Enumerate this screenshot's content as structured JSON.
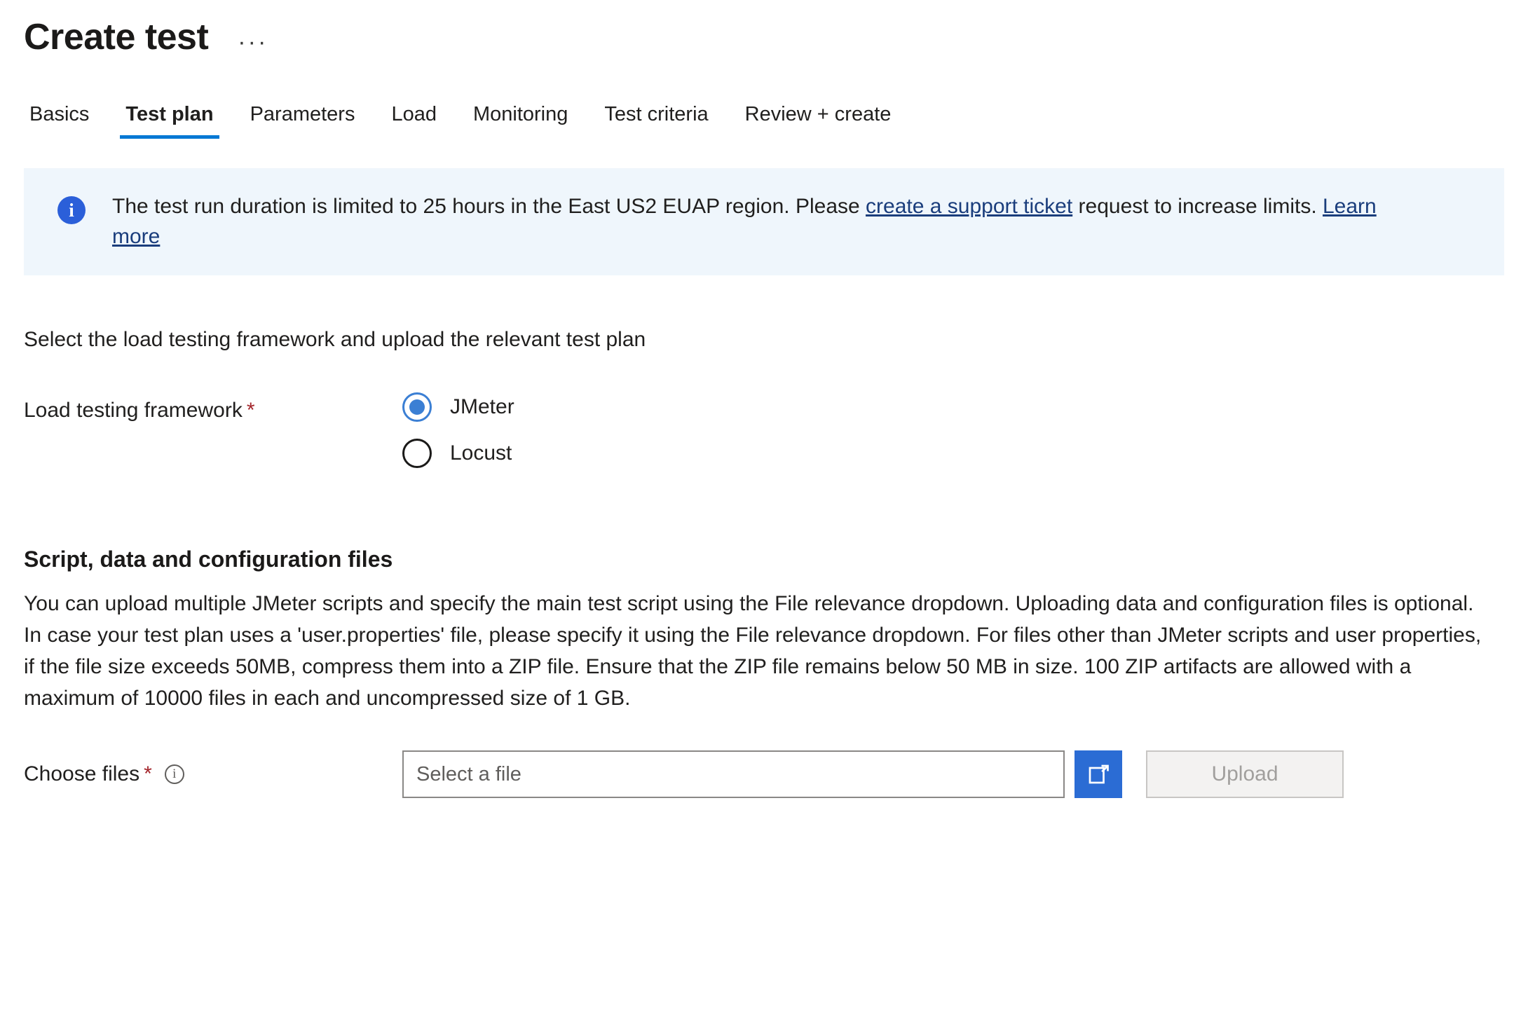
{
  "header": {
    "title": "Create test",
    "more_menu": "···"
  },
  "tabs": [
    {
      "label": "Basics",
      "active": false
    },
    {
      "label": "Test plan",
      "active": true
    },
    {
      "label": "Parameters",
      "active": false
    },
    {
      "label": "Load",
      "active": false
    },
    {
      "label": "Monitoring",
      "active": false
    },
    {
      "label": "Test criteria",
      "active": false
    },
    {
      "label": "Review + create",
      "active": false
    }
  ],
  "banner": {
    "icon": "info-icon",
    "icon_glyph": "i",
    "text_before_link": "The test run duration is limited to 25 hours in the East US2 EUAP region. Please ",
    "link1": "create a support ticket",
    "text_between": " request to increase limits. ",
    "link2": "Learn more",
    "background": "#eff6fc",
    "icon_color": "#2b5fd9",
    "link_color": "#1a3d7c"
  },
  "framework_section": {
    "lead": "Select the load testing framework and upload the relevant test plan",
    "label": "Load testing framework",
    "required_mark": "*",
    "options": [
      {
        "label": "JMeter",
        "selected": true
      },
      {
        "label": "Locust",
        "selected": false
      }
    ],
    "selected_value": "JMeter",
    "accent": "#3b7fd4"
  },
  "script_section": {
    "heading": "Script, data and configuration files",
    "body": "You can upload multiple JMeter scripts and specify the main test script using the File relevance dropdown. Uploading data and configuration files is optional. In case your test plan uses a 'user.properties' file, please specify it using the File relevance dropdown. For files other than JMeter scripts and user properties, if the file size exceeds 50MB, compress them into a ZIP file. Ensure that the ZIP file remains below 50 MB in size. 100 ZIP artifacts are allowed with a maximum of 10000 files in each and uncompressed size of 1 GB."
  },
  "choose_files": {
    "label": "Choose files",
    "required_mark": "*",
    "info_glyph": "i",
    "file_placeholder": "Select a file",
    "file_value": "",
    "browse_icon": "folder-open-icon",
    "upload_label": "Upload",
    "upload_disabled": true,
    "browse_color": "#2b6cd4"
  },
  "colors": {
    "required_red": "#a4262c",
    "tab_underline": "#0078d4"
  }
}
